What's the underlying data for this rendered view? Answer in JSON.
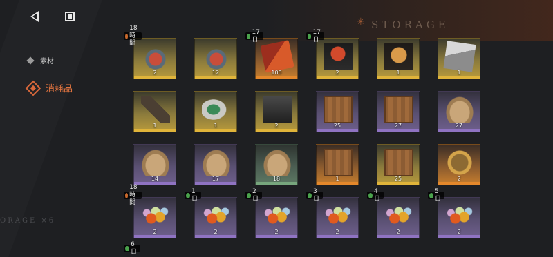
{
  "header": {
    "storage_title": "STORAGE",
    "storage_mark": "✳"
  },
  "nav": {
    "back_icon": "back-triangle-icon",
    "home_icon": "stop-square-icon"
  },
  "categories": [
    {
      "label": "素材",
      "active": false
    },
    {
      "label": "消耗品",
      "active": true
    }
  ],
  "side_decoration": "ORAGE ×6",
  "colors": {
    "accent": "#d9683b",
    "rarity_gold": "#e0b43a",
    "rarity_orange": "#e4882b",
    "rarity_purple": "#8f73c2",
    "rarity_green": "#77a67d"
  },
  "items": [
    {
      "name": "glass-jar-bombs",
      "rarity": "gold",
      "count": "2",
      "tag": "18時間",
      "tag_type": "time",
      "art": "jar"
    },
    {
      "name": "glass-jar-bombs-2",
      "rarity": "gold",
      "count": "12",
      "tag": "",
      "tag_type": "",
      "art": "jar"
    },
    {
      "name": "red-card-pack",
      "rarity": "orange",
      "count": "100",
      "tag": "17日",
      "tag_type": "day",
      "art": "cards"
    },
    {
      "name": "red-rabbit-box",
      "rarity": "gold",
      "count": "2",
      "tag": "17日",
      "tag_type": "day",
      "art": "rabbitbox"
    },
    {
      "name": "gold-rabbit-box",
      "rarity": "gold",
      "count": "1",
      "tag": "",
      "tag_type": "",
      "art": "goldrabbit"
    },
    {
      "name": "photo-pile",
      "rarity": "gold",
      "count": "1",
      "tag": "",
      "tag_type": "",
      "art": "photos"
    },
    {
      "name": "bottle",
      "rarity": "gold",
      "count": "1",
      "tag": "",
      "tag_type": "",
      "art": "bottle"
    },
    {
      "name": "retro-tv",
      "rarity": "gold",
      "count": "1",
      "tag": "",
      "tag_type": "",
      "art": "tv"
    },
    {
      "name": "dark-tv-box",
      "rarity": "gold",
      "count": "2",
      "tag": "",
      "tag_type": "",
      "art": "tvbox"
    },
    {
      "name": "wooden-crate-purple",
      "rarity": "purple",
      "count": "25",
      "tag": "",
      "tag_type": "",
      "art": "crate"
    },
    {
      "name": "wooden-crate-purple-2",
      "rarity": "purple",
      "count": "27",
      "tag": "",
      "tag_type": "",
      "art": "crate"
    },
    {
      "name": "tied-sack-purple",
      "rarity": "purple",
      "count": "27",
      "tag": "",
      "tag_type": "",
      "art": "sack"
    },
    {
      "name": "tied-sack-purple-2",
      "rarity": "purple",
      "count": "14",
      "tag": "",
      "tag_type": "",
      "art": "sack"
    },
    {
      "name": "tied-sack-purple-3",
      "rarity": "purple",
      "count": "17",
      "tag": "",
      "tag_type": "",
      "art": "sack"
    },
    {
      "name": "tied-sack-green",
      "rarity": "green",
      "count": "18",
      "tag": "",
      "tag_type": "",
      "art": "sack"
    },
    {
      "name": "wooden-crate-orange",
      "rarity": "orange",
      "count": "1",
      "tag": "",
      "tag_type": "",
      "art": "crate"
    },
    {
      "name": "wooden-crate-gold",
      "rarity": "gold",
      "count": "25",
      "tag": "",
      "tag_type": "",
      "art": "crate"
    },
    {
      "name": "medal",
      "rarity": "orange",
      "count": "2",
      "tag": "",
      "tag_type": "",
      "art": "medal"
    },
    {
      "name": "fruit-gems-1",
      "rarity": "purple",
      "count": "2",
      "tag": "18時間",
      "tag_type": "time",
      "art": "fruit"
    },
    {
      "name": "fruit-gems-2",
      "rarity": "purple",
      "count": "2",
      "tag": "1日",
      "tag_type": "day",
      "art": "fruit"
    },
    {
      "name": "fruit-gems-3",
      "rarity": "purple",
      "count": "2",
      "tag": "2日",
      "tag_type": "day",
      "art": "fruit"
    },
    {
      "name": "fruit-gems-4",
      "rarity": "purple",
      "count": "2",
      "tag": "3日",
      "tag_type": "day",
      "art": "fruit"
    },
    {
      "name": "fruit-gems-5",
      "rarity": "purple",
      "count": "2",
      "tag": "4日",
      "tag_type": "day",
      "art": "fruit"
    },
    {
      "name": "fruit-gems-6",
      "rarity": "purple",
      "count": "2",
      "tag": "5日",
      "tag_type": "day",
      "art": "fruit"
    }
  ],
  "next_row_tags": [
    {
      "tag": "6日",
      "tag_type": "day"
    }
  ]
}
